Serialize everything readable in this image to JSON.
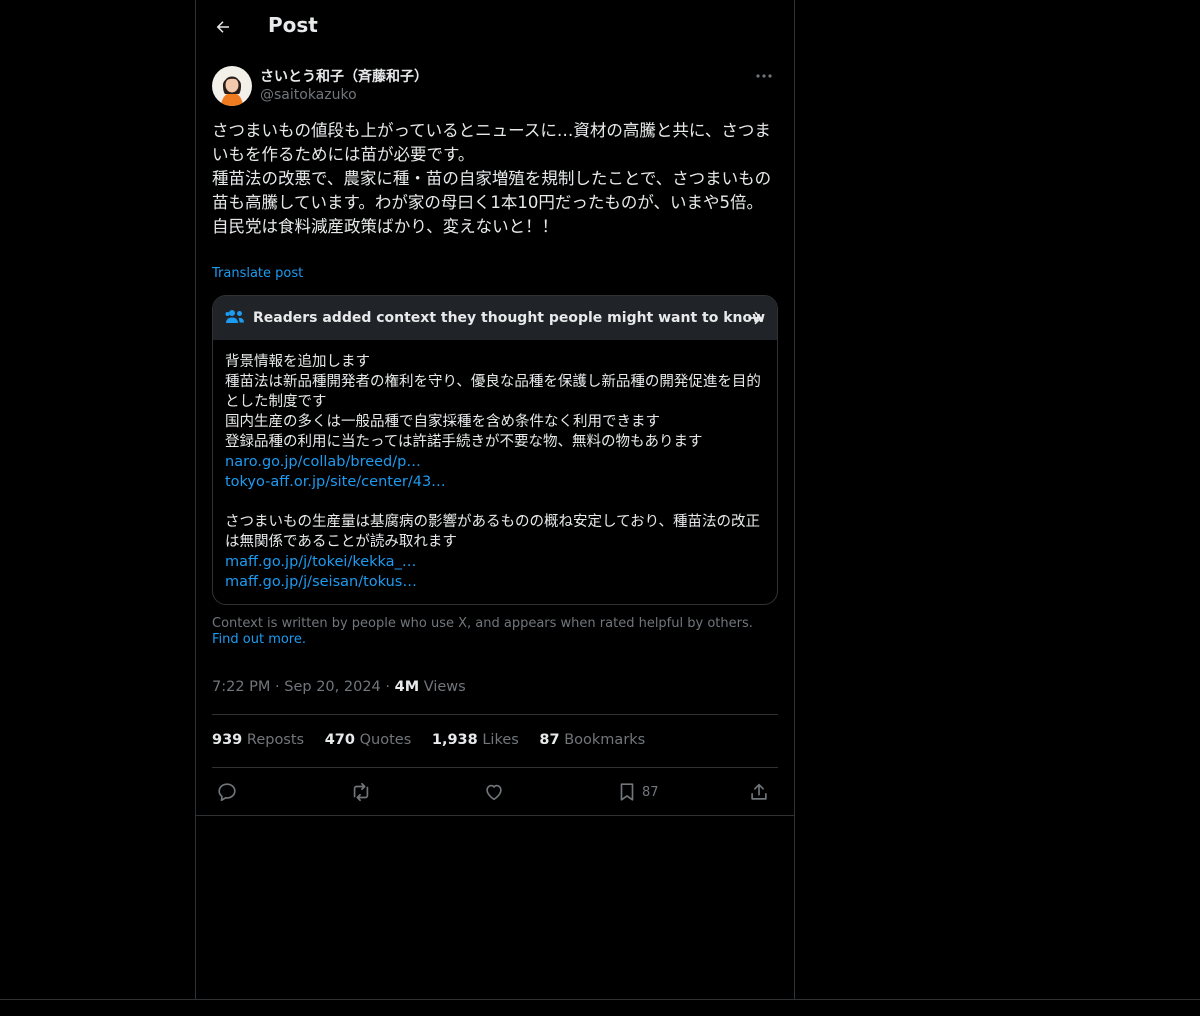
{
  "header": {
    "title": "Post"
  },
  "author": {
    "display_name": "さいとう和子（斉藤和子）",
    "handle": "@saitokazuko"
  },
  "post": {
    "text": "さつまいもの値段も上がっているとニュースに…資材の高騰と共に、さつまいもを作るためには苗が必要です。\n種苗法の改悪で、農家に種・苗の自家増殖を規制したことで、さつまいもの苗も高騰しています。わが家の母曰く1本10円だったものが、いまや5倍。\n自民党は食料減産政策ばかり、変えないと！！",
    "translate_label": "Translate post"
  },
  "community_note": {
    "header": "Readers added context they thought people might want to know",
    "lines1": [
      "背景情報を追加します",
      "種苗法は新品種開発者の権利を守り、優良な品種を保護し新品種の開発促進を目的とした制度です",
      "国内生産の多くは一般品種で自家採種を含め条件なく利用できます",
      "登録品種の利用に当たっては許諾手続きが不要な物、無料の物もあります"
    ],
    "links1": [
      "naro.go.jp/collab/breed/p…",
      "tokyo-aff.or.jp/site/center/43…"
    ],
    "lines2": [
      "さつまいもの生産量は基腐病の影響があるものの概ね安定しており、種苗法の改正は無関係であることが読み取れます"
    ],
    "links2": [
      "maff.go.jp/j/tokei/kekka_…",
      "maff.go.jp/j/seisan/tokus…"
    ]
  },
  "disclaimer": {
    "text": "Context is written by people who use X, and appears when rated helpful by others.",
    "link": "Find out more."
  },
  "meta": {
    "time": "7:22 PM",
    "date": "Sep 20, 2024",
    "views_count": "4M",
    "views_label": "Views"
  },
  "stats": {
    "reposts_count": "939",
    "reposts_label": "Reposts",
    "quotes_count": "470",
    "quotes_label": "Quotes",
    "likes_count": "1,938",
    "likes_label": "Likes",
    "bookmarks_count": "87",
    "bookmarks_label": "Bookmarks"
  },
  "actions": {
    "bookmark_count": "87",
    "icons": [
      "reply-icon",
      "repost-icon",
      "like-icon",
      "bookmark-icon",
      "share-icon"
    ]
  },
  "colors": {
    "background": "#000000",
    "text": "#e7e9ea",
    "muted": "#71767b",
    "link": "#1d9bf0",
    "border": "#2f3336",
    "note_header": "#202327"
  }
}
